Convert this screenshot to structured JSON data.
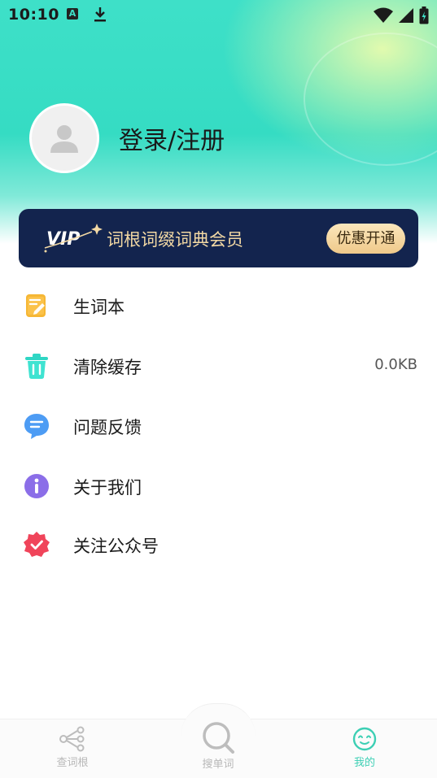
{
  "status_bar": {
    "time": "10:10",
    "icons": [
      "a-notification-icon",
      "download-icon",
      "wifi-icon",
      "signal-icon",
      "battery-icon"
    ]
  },
  "profile": {
    "login_label": "登录/注册",
    "avatar_icon": "user-icon"
  },
  "vip": {
    "logo_text": "VIP",
    "title": "词根词缀词典会员",
    "button_label": "优惠开通"
  },
  "menu": {
    "items": [
      {
        "label": "生词本",
        "icon": "notebook-icon",
        "value": ""
      },
      {
        "label": "清除缓存",
        "icon": "trash-icon",
        "value": "0.0KB"
      },
      {
        "label": "问题反馈",
        "icon": "feedback-icon",
        "value": ""
      },
      {
        "label": "关于我们",
        "icon": "info-icon",
        "value": ""
      },
      {
        "label": "关注公众号",
        "icon": "badge-check-icon",
        "value": ""
      }
    ]
  },
  "tabbar": {
    "tabs": [
      {
        "label": "查词根",
        "icon": "root-tree-icon",
        "active": false
      },
      {
        "label": "搜单词",
        "icon": "search-icon",
        "active": false
      },
      {
        "label": "我的",
        "icon": "profile-face-icon",
        "active": true
      }
    ]
  },
  "colors": {
    "accent": "#3ee0c8",
    "vip_bg": "#13244e",
    "vip_gold": "#f3d9a4"
  }
}
